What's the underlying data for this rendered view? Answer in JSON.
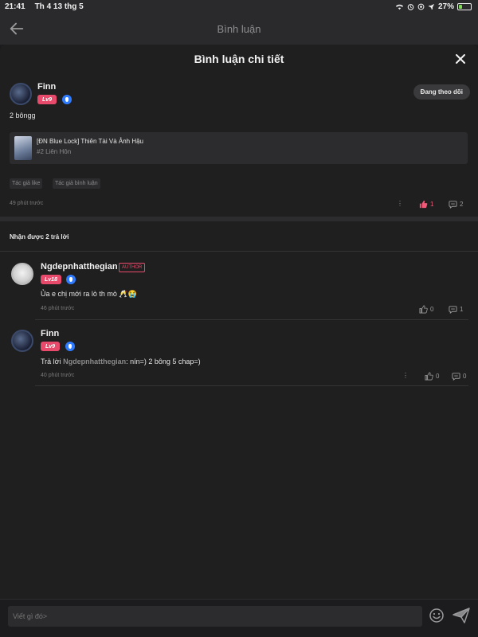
{
  "status_bar": {
    "time": "21:41",
    "date": "Th 4 13 thg 5",
    "battery_percent": "27%",
    "battery_level": 0.27,
    "icons": [
      "wifi-icon",
      "alarm-icon",
      "location-icon",
      "rocket-icon"
    ]
  },
  "app_bar": {
    "title": "Bình luận",
    "back_icon": "arrow-left-icon"
  },
  "sheet": {
    "title": "Bình luận chi tiết",
    "close_icon": "close-icon"
  },
  "main_comment": {
    "username": "Finn",
    "level": "Lv9",
    "follow_label": "Đang theo dõi",
    "text": "2 bôngg",
    "story": {
      "title": "[ĐN Blue Lock] Thiên Tài Và Ảnh Hậu",
      "chapter": "#2 Liên Hôn"
    },
    "tags": [
      "Tác giả like",
      "Tác giả bình luận"
    ],
    "time": "49 phút trước",
    "likes": "1",
    "replies": "2"
  },
  "replies_heading": "Nhận được 2 trả lời",
  "replies": [
    {
      "username": "Ngdepnhatthegian",
      "badge": "AUTHOR",
      "level": "Lv18",
      "text": "Ủa e chị mới ra lò th mò 🥂😭",
      "time": "46 phút trước",
      "likes": "0",
      "replies": "1"
    },
    {
      "username": "Finn",
      "level": "Lv9",
      "reply_prefix": "Trả lời ",
      "reply_to": "Ngdepnhatthegian",
      "text": ": nín=) 2 bông 5 chap=)",
      "time": "40 phút trước",
      "likes": "0",
      "replies": "0"
    }
  ],
  "input": {
    "placeholder": "Viết gì đó>"
  },
  "colors": {
    "background": "#1f1f1f",
    "accent_pink": "#e84a6b",
    "verify_blue": "#2f7bff",
    "like_active": "#f05a78"
  }
}
